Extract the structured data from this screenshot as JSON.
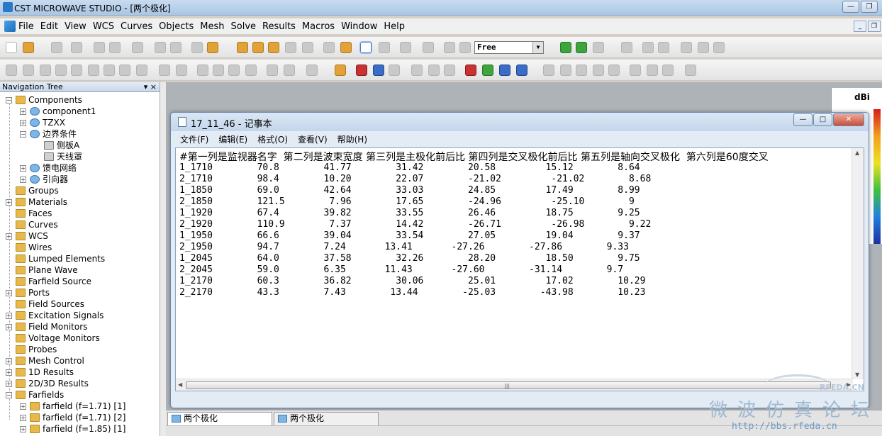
{
  "window": {
    "title": "CST MICROWAVE STUDIO - [两个极化]"
  },
  "menubar": {
    "items": [
      "File",
      "Edit",
      "View",
      "WCS",
      "Curves",
      "Objects",
      "Mesh",
      "Solve",
      "Results",
      "Macros",
      "Window",
      "Help"
    ]
  },
  "toolbar": {
    "solver_select": "Free"
  },
  "navtree": {
    "title": "Navigation Tree",
    "items": [
      {
        "label": "Components"
      },
      {
        "label": "component1"
      },
      {
        "label": "TZXX"
      },
      {
        "label": "边界条件"
      },
      {
        "label": "侧板A"
      },
      {
        "label": "天线罩"
      },
      {
        "label": "馈电网络"
      },
      {
        "label": "引向器"
      },
      {
        "label": "Groups"
      },
      {
        "label": "Materials"
      },
      {
        "label": "Faces"
      },
      {
        "label": "Curves"
      },
      {
        "label": "WCS"
      },
      {
        "label": "Wires"
      },
      {
        "label": "Lumped Elements"
      },
      {
        "label": "Plane Wave"
      },
      {
        "label": "Farfield Source"
      },
      {
        "label": "Ports"
      },
      {
        "label": "Field Sources"
      },
      {
        "label": "Excitation Signals"
      },
      {
        "label": "Field Monitors"
      },
      {
        "label": "Voltage Monitors"
      },
      {
        "label": "Probes"
      },
      {
        "label": "Mesh Control"
      },
      {
        "label": "1D Results"
      },
      {
        "label": "2D/3D Results"
      },
      {
        "label": "Farfields"
      },
      {
        "label": "farfield (f=1.71) [1]"
      },
      {
        "label": "farfield (f=1.71) [2]"
      },
      {
        "label": "farfield (f=1.85) [1]"
      }
    ]
  },
  "result_panel": {
    "unit": "dBi"
  },
  "notepad": {
    "title": "17_11_46 - 记事本",
    "menu": [
      "文件(F)",
      "编辑(E)",
      "格式(O)",
      "查看(V)",
      "帮助(H)"
    ],
    "header": "#第一列是监视器名字  第二列是波束宽度 第三列是主极化前后比 第四列是交叉极化前后比 第五列是轴向交叉极化  第六列是60度交叉",
    "rows": [
      "1_1710        70.8        41.77        31.42        20.58         15.12        8.64",
      "2_1710        98.4        10.20        22.07        -21.02         -21.02        8.68",
      "1_1850        69.0        42.64        33.03        24.85         17.49        8.99",
      "2_1850        121.5        7.96        17.65        -24.96         -25.10        9",
      "1_1920        67.4        39.82        33.55        26.46         18.75        9.25",
      "2_1920        110.9        7.37        14.42        -26.71         -26.98        9.22",
      "1_1950        66.6        39.04        33.54        27.05         19.04        9.37",
      "2_1950        94.7        7.24       13.41       -27.26        -27.86        9.33",
      "1_2045        64.0        37.58        32.26        28.20         18.50        9.75",
      "2_2045        59.0        6.35       11.43       -27.60        -31.14        9.7",
      "1_2170        60.3        36.82        30.06        25.01         17.02        10.29",
      "2_2170        43.3        7.43        13.44        -25.03        -43.98        10.23"
    ]
  },
  "bottom_tabs": [
    "两个极化",
    "两个极化"
  ],
  "watermark": {
    "brand": "RFEDA.CN",
    "cn": "微波仿真论坛",
    "url": "http://bbs.rfeda.cn"
  }
}
